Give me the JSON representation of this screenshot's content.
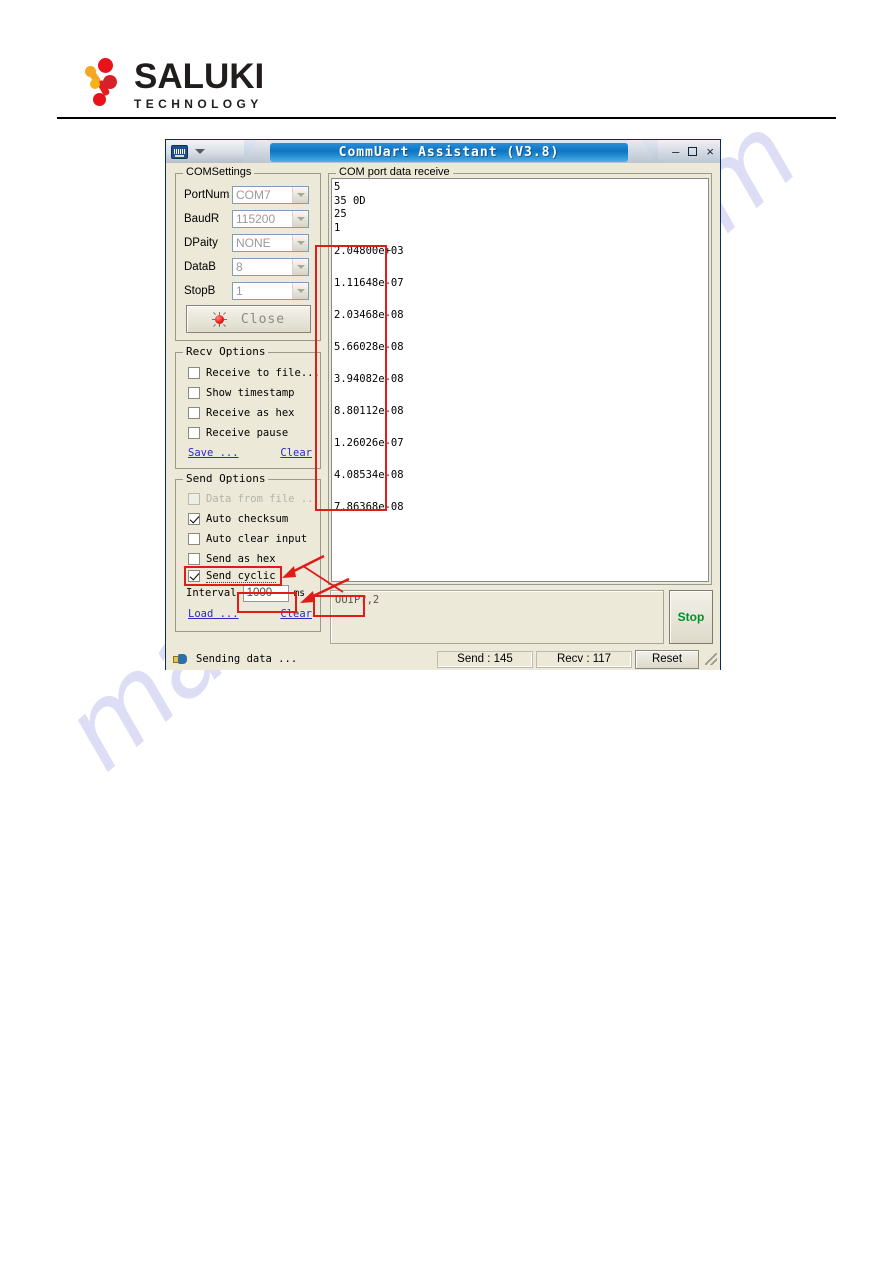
{
  "header": {
    "brand_name": "SALUKI",
    "brand_tagline": "TECHNOLOGY",
    "logo_colors": {
      "orange": "#f5a623",
      "red": "#e8131a"
    }
  },
  "watermark": {
    "text": "manualshive.com",
    "color": "#c9caf0"
  },
  "window": {
    "title": "CommUart Assistant (V3.8)",
    "app_icon": "uart-app-icon",
    "menu_caret": "chevron-down-icon",
    "controls": {
      "minimize": "–",
      "maximize": "maximize-icon",
      "close": "×"
    }
  },
  "com_settings": {
    "legend": "COMSettings",
    "rows": [
      {
        "label": "PortNum",
        "value": "COM7"
      },
      {
        "label": "BaudR",
        "value": "115200"
      },
      {
        "label": "DPaity",
        "value": "NONE"
      },
      {
        "label": "DataB",
        "value": "8"
      },
      {
        "label": "StopB",
        "value": "1"
      }
    ],
    "action_button": {
      "label": "Close",
      "indicator_color": "#ee1c1c",
      "state": "connected"
    }
  },
  "recv_options": {
    "legend": "Recv Options",
    "checkboxes": [
      {
        "label": "Receive to file...",
        "checked": false,
        "disabled": false
      },
      {
        "label": "Show timestamp",
        "checked": false,
        "disabled": false
      },
      {
        "label": "Receive as hex",
        "checked": false,
        "disabled": false
      },
      {
        "label": "Receive pause",
        "checked": false,
        "disabled": false
      }
    ],
    "links": {
      "save": "Save ...",
      "clear": "Clear"
    }
  },
  "send_options": {
    "legend": "Send Options",
    "checkboxes": [
      {
        "label": "Data from file ...",
        "checked": false,
        "disabled": true
      },
      {
        "label": "Auto checksum",
        "checked": true,
        "disabled": false
      },
      {
        "label": "Auto clear input",
        "checked": false,
        "disabled": false
      },
      {
        "label": "Send as hex",
        "checked": false,
        "disabled": false
      },
      {
        "label": "Send cyclic",
        "checked": true,
        "disabled": false
      }
    ],
    "interval": {
      "label": "Interval",
      "value": "1000",
      "unit": "ms"
    },
    "links": {
      "load": "Load ...",
      "clear": "Clear"
    }
  },
  "receive_panel": {
    "legend": "COM port data receive",
    "lines": [
      "5",
      "35 0D",
      "25",
      "1"
    ],
    "measured_values": [
      "2.04800e+03",
      "1.11648e-07",
      "2.03468e-08",
      "5.66028e-08",
      "3.94082e-08",
      "8.80112e-08",
      "1.26026e-07",
      "4.08534e-08",
      "7.86368e-08"
    ]
  },
  "send_panel": {
    "input_value": "OUIP?,2",
    "stop_button": {
      "label": "Stop",
      "color": "#00912c"
    }
  },
  "statusbar": {
    "status_icon": "hand-pointer-icon",
    "status_text": "Sending data ...",
    "send_count": "Send : 145",
    "recv_count": "Recv : 117",
    "reset_button": "Reset"
  },
  "annotations": {
    "highlight_color": "#e01b18"
  }
}
